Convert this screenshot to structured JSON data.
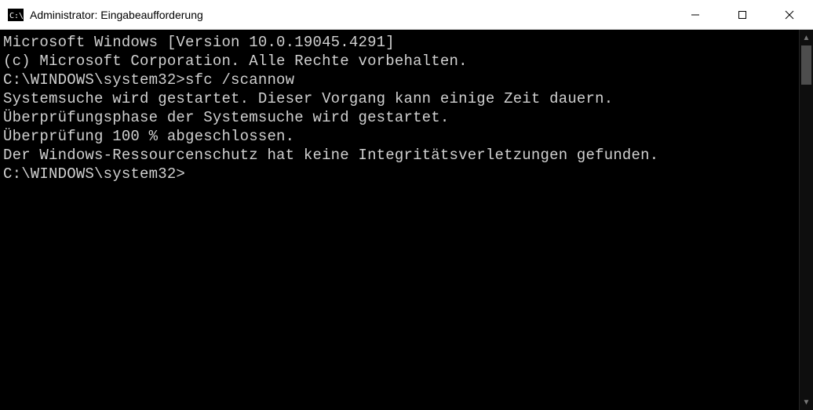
{
  "titlebar": {
    "title": "Administrator: Eingabeaufforderung"
  },
  "terminal": {
    "lines": [
      "Microsoft Windows [Version 10.0.19045.4291]",
      "(c) Microsoft Corporation. Alle Rechte vorbehalten.",
      "",
      "C:\\WINDOWS\\system32>sfc /scannow",
      "",
      "Systemsuche wird gestartet. Dieser Vorgang kann einige Zeit dauern.",
      "",
      "Überprüfungsphase der Systemsuche wird gestartet.",
      "Überprüfung 100 % abgeschlossen.",
      "",
      "Der Windows-Ressourcenschutz hat keine Integritätsverletzungen gefunden.",
      "",
      "C:\\WINDOWS\\system32>"
    ]
  }
}
